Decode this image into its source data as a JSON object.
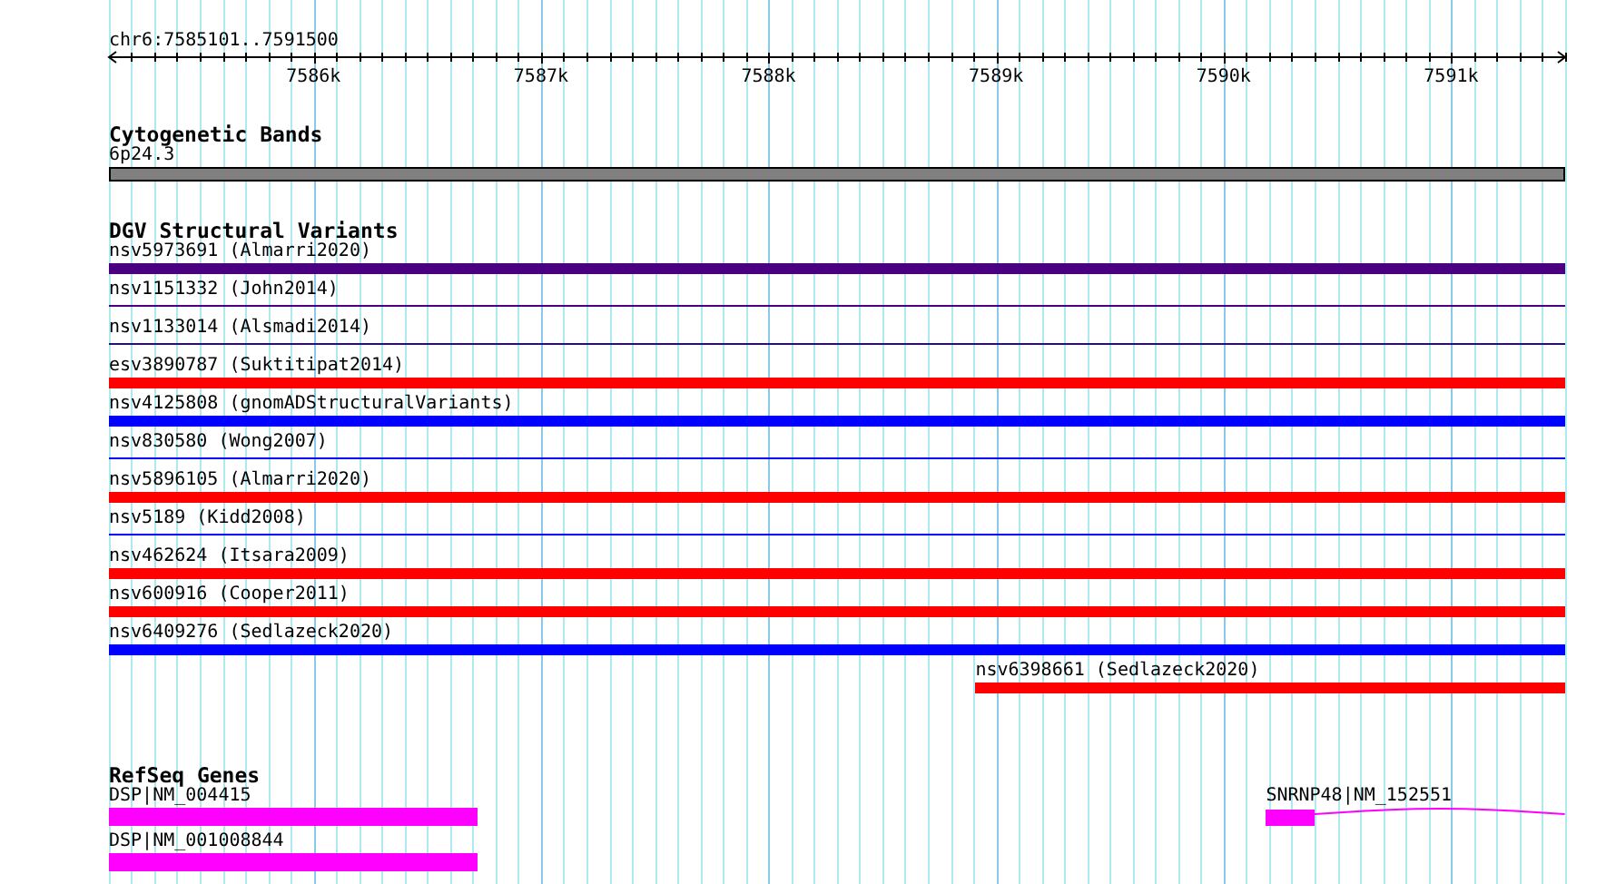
{
  "ruler": {
    "range": "chr6:7585101..7591500",
    "ticks": [
      "7586k",
      "7587k",
      "7588k",
      "7589k",
      "7590k",
      "7591k"
    ]
  },
  "tracks": [
    {
      "title": "Cytogenetic Bands",
      "kind": "band",
      "rows": [
        {
          "features": [
            {
              "label": "6p24.3",
              "kind": "band",
              "color": "#808080"
            }
          ]
        }
      ]
    },
    {
      "title": "DGV Structural Variants",
      "kind": "variants",
      "rows": [
        {
          "features": [
            {
              "label": "nsv5973691 (Almarri2020)",
              "kind": "thick",
              "color": "#4b0082"
            }
          ]
        },
        {
          "features": [
            {
              "label": "nsv1151332 (John2014)",
              "kind": "thin",
              "color": "#4b0082"
            }
          ]
        },
        {
          "features": [
            {
              "label": "nsv1133014 (Alsmadi2014)",
              "kind": "thin",
              "color": "#2a1070"
            }
          ]
        },
        {
          "features": [
            {
              "label": "esv3890787 (Suktitipat2014)",
              "kind": "thick",
              "color": "#ff0000"
            }
          ]
        },
        {
          "features": [
            {
              "label": "nsv4125808 (gnomADStructuralVariants)",
              "kind": "thick",
              "color": "#0000ff"
            }
          ]
        },
        {
          "features": [
            {
              "label": "nsv830580 (Wong2007)",
              "kind": "thin",
              "color": "#0000ff"
            }
          ]
        },
        {
          "features": [
            {
              "label": "nsv5896105 (Almarri2020)",
              "kind": "thick",
              "color": "#ff0000"
            }
          ]
        },
        {
          "features": [
            {
              "label": "nsv5189 (Kidd2008)",
              "kind": "thin",
              "color": "#0000ff"
            }
          ]
        },
        {
          "features": [
            {
              "label": "nsv462624 (Itsara2009)",
              "kind": "thick",
              "color": "#ff0000"
            }
          ]
        },
        {
          "features": [
            {
              "label": "nsv600916 (Cooper2011)",
              "kind": "thick",
              "color": "#ff0000"
            }
          ]
        },
        {
          "features": [
            {
              "label": "nsv6409276 (Sedlazeck2020)",
              "kind": "thick",
              "color": "#0000ff"
            }
          ]
        },
        {
          "features": [
            {
              "label": "nsv6398661 (Sedlazeck2020)",
              "kind": "partial",
              "color": "#ff0000"
            }
          ]
        }
      ]
    },
    {
      "title": "RefSeq Genes",
      "kind": "genes",
      "rows": [
        {
          "features": [
            {
              "label": "DSP|NM_004415",
              "kind": "gene",
              "color": "#ff00ff"
            },
            {
              "label": "SNRNP48|NM_152551",
              "kind": "model",
              "color": "#ff00ff"
            }
          ]
        },
        {
          "features": [
            {
              "label": "DSP|NM_001008844",
              "kind": "gene",
              "color": "#ff00ff"
            }
          ]
        }
      ]
    }
  ]
}
